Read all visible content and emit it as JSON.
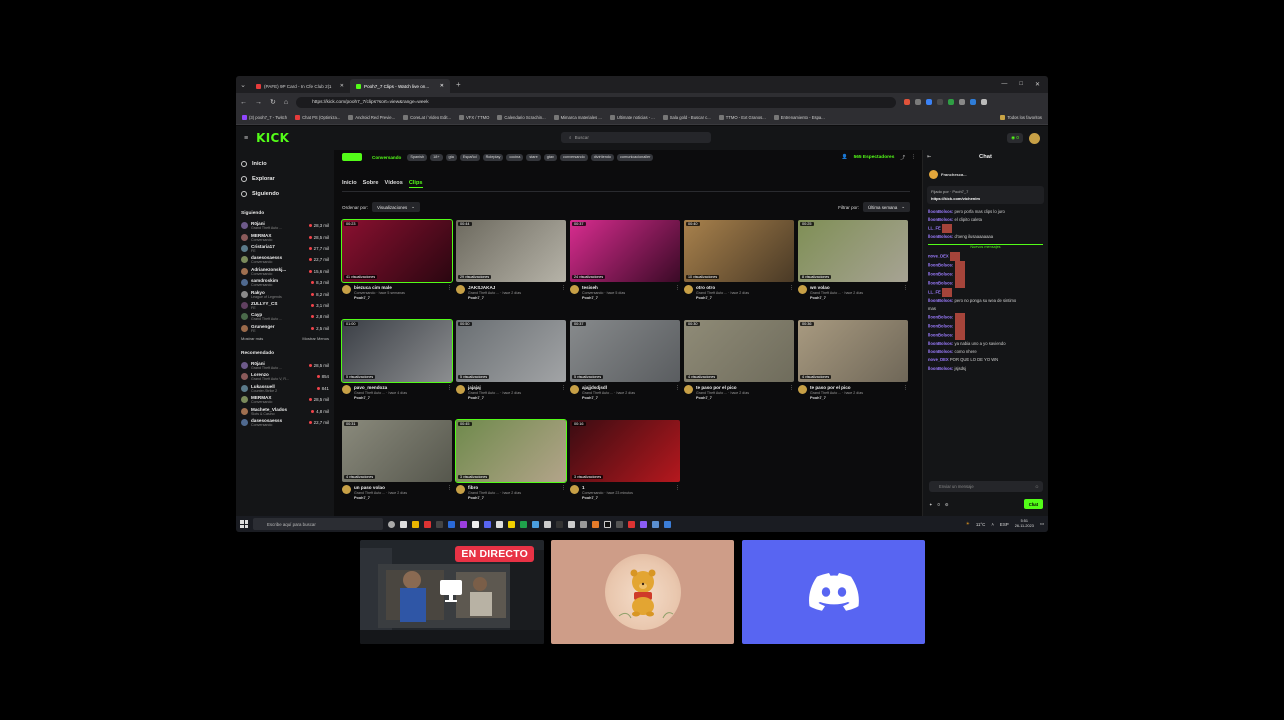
{
  "browser": {
    "tabs": [
      {
        "label": "(PAFE) 9P Card - In Cfe Club 2|1",
        "color": "#e53b3b",
        "active": false
      },
      {
        "label": "Pooh7_7 Clips - Watch live on...",
        "color": "#53fc18",
        "active": true
      }
    ],
    "url": "https://kick.com/pooh7_7/clips?sort=view&range=week",
    "bookmarks": [
      "(3) pooh7_7 - Twitch",
      "Chat PS (Optimiza...",
      "Android Red Previe...",
      "CoreLat / Video Edit...",
      "VFX / TTMO",
      "Calendario Scrachin...",
      "Mimarca materiales ...",
      "Ultimate noticias - ...",
      "Sala gold - Buscar c...",
      "TTMO - Ext Granos...",
      "Entrenamiento - Espa...",
      "Todos los favoritos"
    ]
  },
  "kick": {
    "logo": "KICK",
    "search_placeholder": "Buscar",
    "nav": [
      {
        "label": "Inicio",
        "icon": "home-icon"
      },
      {
        "label": "Explorar",
        "icon": "compass-icon"
      },
      {
        "label": "Siguiendo",
        "icon": "heart-icon"
      }
    ],
    "following_header": "Siguiendo",
    "following": [
      {
        "name": "R0jani",
        "cat": "Grand Theft Auto ...",
        "viewers": "28,3 mil"
      },
      {
        "name": "MERMAX",
        "cat": "Conversando",
        "viewers": "28,5 mil"
      },
      {
        "name": "Cristaria17",
        "cat": "FE",
        "viewers": "27,7 mil"
      },
      {
        "name": "dasesosaesss",
        "cat": "Conversando",
        "viewers": "22,7 mil"
      },
      {
        "name": "Adrianezonskj...",
        "cat": "Conversando",
        "viewers": "15,6 mil"
      },
      {
        "name": "samdroskim",
        "cat": "Conversando",
        "viewers": "8,3 mil"
      },
      {
        "name": "Rakyo",
        "cat": "League of Legends",
        "viewers": "8,2 mil"
      },
      {
        "name": "ZULLYY_CS",
        "cat": "FE",
        "viewers": "3,1 mil"
      },
      {
        "name": "Cayp",
        "cat": "Grand Theft Auto ...",
        "viewers": "2,8 mil"
      },
      {
        "name": "Grunenger",
        "cat": "FE",
        "viewers": "2,5 mil"
      }
    ],
    "show_more": "Mostrar más",
    "show_less": "Mostrar Menos",
    "recommended_header": "Recomendado",
    "recommended": [
      {
        "name": "R0jani",
        "cat": "Grand Theft Auto ...",
        "viewers": "28,5 mil"
      },
      {
        "name": "Lorenzo",
        "cat": "Grand Theft Auto V, R...",
        "viewers": "854"
      },
      {
        "name": "Lukassuell",
        "cat": "Counter-Strike 2",
        "viewers": "841"
      },
      {
        "name": "MERMAX",
        "cat": "Conversando",
        "viewers": "28,5 mil"
      },
      {
        "name": "Machete_Vlados",
        "cat": "Slots & Casino",
        "viewers": "4,8 mil"
      },
      {
        "name": "dasesosaesss",
        "cat": "Conversando",
        "viewers": "22,7 mil"
      }
    ],
    "channel": {
      "status": "Conversando",
      "tags": [
        "Spanish",
        "18+",
        "gta",
        "Español",
        "Roleplay",
        "cocina",
        "stare",
        "gtav",
        "conversando",
        "divirtiendo",
        "comunicacionaller"
      ],
      "viewers": "565 Espectadores"
    },
    "subtabs": [
      "Inicio",
      "Sobre",
      "Vídeos",
      "Clips"
    ],
    "active_subtab": "Clips",
    "sort_label": "Ordenar por:",
    "sort_value": "Visualizaciones",
    "filter_label": "Filtrar por:",
    "filter_value": "Última semana",
    "clips": [
      {
        "title": "biezuca cim male",
        "dur": "00:23",
        "views": "41 visualizaciones",
        "cat": "Conversando · hace 5 semanas",
        "by": "Pooh7_7",
        "c1": "#8a1030",
        "c2": "#2a0610"
      },
      {
        "title": "JAKSJAKAJ",
        "dur": "00:44",
        "views": "29 visualizaciones",
        "cat": "Grand Theft Auto ... · hace 2 días",
        "by": "Pooh7_7",
        "c1": "#6d6a5f",
        "c2": "#b6b3a8"
      },
      {
        "title": "tesiseh",
        "dur": "00:37",
        "views": "24 visualizaciones",
        "cat": "Conversando · hace 5 días",
        "by": "Pooh7_7",
        "c1": "#d82c8f",
        "c2": "#3a0a26"
      },
      {
        "title": "otro otro",
        "dur": "00:40",
        "views": "10 visualizaciones",
        "cat": "Grand Theft Auto ... · hace 2 días",
        "by": "Pooh7_7",
        "c1": "#a8814c",
        "c2": "#4a3a26"
      },
      {
        "title": "wn volao",
        "dur": "00:25",
        "views": "8 visualizaciones",
        "cat": "Grand Theft Auto ... · hace 2 días",
        "by": "Pooh7_7",
        "c1": "#7f8f55",
        "c2": "#a7a394"
      },
      {
        "title": "pavo_mendoza",
        "dur": "01:00",
        "views": "5 visualizaciones",
        "cat": "Grand Theft Auto ... · hace 4 días",
        "by": "Pooh7_7",
        "c1": "#3b3f46",
        "c2": "#8c8e90"
      },
      {
        "title": "jajajaj",
        "dur": "00:50",
        "views": "5 visualizaciones",
        "cat": "Grand Theft Auto ... · hace 2 días",
        "by": "Pooh7_7",
        "c1": "#6a6f73",
        "c2": "#a2a4a6"
      },
      {
        "title": "ajajjdsdjsdl",
        "dur": "00:37",
        "views": "5 visualizaciones",
        "cat": "Grand Theft Auto ... · hace 2 días",
        "by": "Pooh7_7",
        "c1": "#878a8c",
        "c2": "#5a5d60"
      },
      {
        "title": "te paso por el pico",
        "dur": "00:30",
        "views": "4 visualizaciones",
        "cat": "Grand Theft Auto ... · hace 2 días",
        "by": "Pooh7_7",
        "c1": "#8f8b77",
        "c2": "#6f6c5c"
      },
      {
        "title": "te paso por el pico",
        "dur": "00:36",
        "views": "4 visualizaciones",
        "cat": "Grand Theft Auto ... · hace 2 días",
        "by": "Pooh7_7",
        "c1": "#a89a80",
        "c2": "#6f6758"
      },
      {
        "title": "un paso volao",
        "dur": "00:31",
        "views": "4 visualizaciones",
        "cat": "Grand Theft Auto ... · hace 2 días",
        "by": "Pooh7_7",
        "c1": "#8a8a7c",
        "c2": "#56574d"
      },
      {
        "title": "fibro",
        "dur": "00:45",
        "views": "3 visualizaciones",
        "cat": "Grand Theft Auto ... · hace 2 días",
        "by": "Pooh7_7",
        "c1": "#6f8a4c",
        "c2": "#b3a48a"
      },
      {
        "title": "1",
        "dur": "00:16",
        "views": "3 visualizaciones",
        "cat": "Conversando · hace 23 minutos",
        "by": "Pooh7_7",
        "c1": "#3a0c12",
        "c2": "#b5181e"
      }
    ],
    "chat": {
      "title": "Chat",
      "gifter": "Franchesca...",
      "pinned_by": "Fijado por · Pooh7_7",
      "pinned_link": "https://kick.com/vichenim",
      "messages": [
        {
          "user": "lloonBolsos:",
          "text": "pero porfa mas clips lo juro"
        },
        {
          "user": "lloonBolsos:",
          "text": "el clipito caleta"
        },
        {
          "user": "LL_FE",
          "text": ""
        },
        {
          "user": "lloonBolsos:",
          "text": "d'oeng ilusaaaaaaaa"
        }
      ],
      "new_messages": "Nuevos mensajes",
      "messages2": [
        {
          "user": "nove_DEX",
          "text": ""
        },
        {
          "user": "lloonBolsos:",
          "text": ""
        },
        {
          "user": "lloonBolsos:",
          "text": ""
        },
        {
          "user": "lloonBolsos:",
          "text": ""
        },
        {
          "user": "LL_FE",
          "text": ""
        },
        {
          "user": "lloonBolsos:",
          "text": "pero no ponga su wea de sintimo"
        },
        {
          "user": "",
          "text": "mas"
        },
        {
          "user": "lloonBolsos:",
          "text": ""
        },
        {
          "user": "lloonBolsos:",
          "text": ""
        },
        {
          "user": "lloonBolsos:",
          "text": ""
        },
        {
          "user": "lloonBolsos:",
          "text": "ya nabia uno a yo saviendo"
        },
        {
          "user": "lloonBolsos:",
          "text": "como nhere"
        },
        {
          "user": "nove_DEX",
          "text": "POR QUE LO DE YO WN"
        },
        {
          "user": "lloonBolsos:",
          "text": "jsjsdsj"
        }
      ],
      "input_placeholder": "Enviar un mensaje",
      "kicks": "0",
      "send": "Chat"
    }
  },
  "taskbar": {
    "search_placeholder": "Escribe aquí para buscar",
    "weather": "11°C",
    "lang": "ESP",
    "time": "5:51",
    "date": "26-11-2023"
  },
  "overlay": {
    "live_badge": "EN DIRECTO"
  }
}
